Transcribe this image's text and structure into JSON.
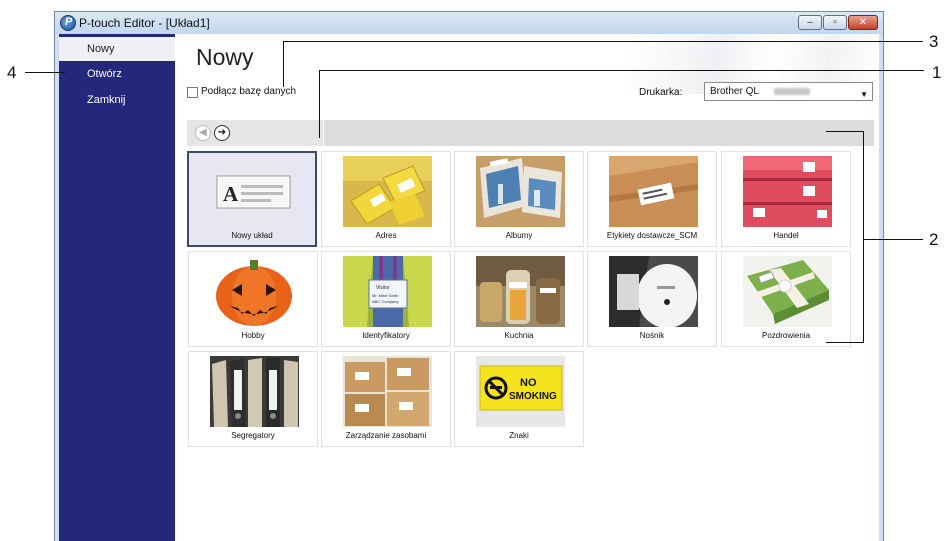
{
  "window": {
    "title": "P-touch Editor - [Układ1]",
    "controls": {
      "minimize": "–",
      "maximize": "▫",
      "close": "✕"
    }
  },
  "sidebar": {
    "items": [
      {
        "label": "Nowy",
        "active": true
      },
      {
        "label": "Otwórz",
        "active": false
      },
      {
        "label": "Zamknij",
        "active": false
      }
    ]
  },
  "main": {
    "title": "Nowy",
    "connect_db_label": "Podłącz bazę danych",
    "connect_db_checked": false,
    "printer_label": "Drukarka:",
    "printer_value": "Brother QL",
    "nav": {
      "back_icon": "◀",
      "forward_icon": "➔"
    }
  },
  "templates": [
    {
      "label": "Nowy układ",
      "icon": "new-layout-icon",
      "selected": true
    },
    {
      "label": "Adres",
      "icon": "address-labels-photo"
    },
    {
      "label": "Albumy",
      "icon": "album-photo"
    },
    {
      "label": "Etykiety dostawcze_SCM",
      "icon": "shipping-box-photo"
    },
    {
      "label": "Handel",
      "icon": "retail-photo"
    },
    {
      "label": "Hobby",
      "icon": "pumpkin-photo"
    },
    {
      "label": "Identyfikatory",
      "icon": "visitor-badge-photo"
    },
    {
      "label": "Kuchnia",
      "icon": "kitchen-jars-photo"
    },
    {
      "label": "Nośnik",
      "icon": "media-disc-photo"
    },
    {
      "label": "Pozdrowienia",
      "icon": "gift-photo"
    },
    {
      "label": "Segregatory",
      "icon": "binders-photo"
    },
    {
      "label": "Zarządzanie zasobami",
      "icon": "asset-boxes-photo"
    },
    {
      "label": "Znaki",
      "icon": "no-smoking-sign-photo"
    }
  ],
  "thumb_texts": {
    "visitor": "Visitor",
    "visitor_name": "Mr. Mike Smith",
    "visitor_company": "ABC Company",
    "no": "NO",
    "smoking": "SMOKING"
  },
  "callouts": [
    "3",
    "1",
    "4",
    "2"
  ],
  "colors": {
    "sidebar": "#24287a",
    "selected_tile": "#e7e7f2",
    "close_button": "#c2412a"
  }
}
